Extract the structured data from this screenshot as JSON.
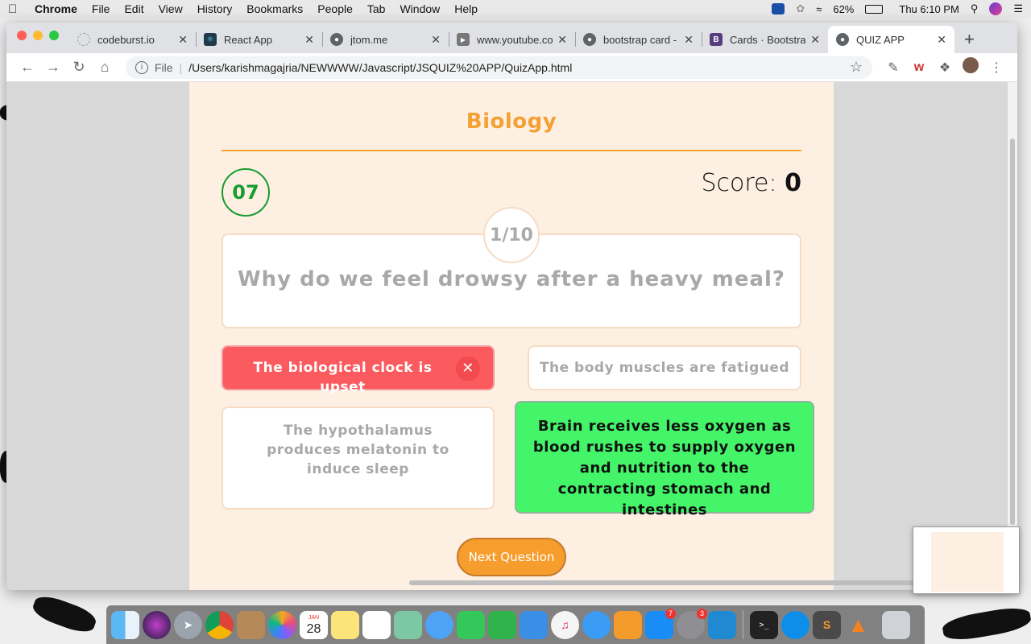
{
  "menubar": {
    "app": "Chrome",
    "items": [
      "File",
      "Edit",
      "View",
      "History",
      "Bookmarks",
      "People",
      "Tab",
      "Window",
      "Help"
    ],
    "battery": "62%",
    "clock": "Thu 6:10 PM"
  },
  "browser": {
    "tabs": [
      {
        "title": "codeburst.io",
        "icon": "codeburst-icon",
        "color": "#888888"
      },
      {
        "title": "React App",
        "icon": "react-icon",
        "color": "#1f3a4a"
      },
      {
        "title": "jtom.me",
        "icon": "globe-icon",
        "color": "#5f6368"
      },
      {
        "title": "www.youtube.com",
        "icon": "youtube-icon",
        "color": "#777777"
      },
      {
        "title": "bootstrap card -",
        "icon": "globe-icon",
        "color": "#5f6368"
      },
      {
        "title": "Cards · Bootstrap",
        "icon": "bootstrap-icon",
        "color": "#563d7c"
      },
      {
        "title": "QUIZ APP",
        "icon": "globe-icon",
        "color": "#5f6368"
      }
    ],
    "address": {
      "scheme": "File",
      "url": "/Users/karishmagajria/NEWWWW/Javascript/JSQUIZ%20APP/QuizApp.html"
    }
  },
  "quiz": {
    "subject": "Biology",
    "timer": "07",
    "score_label": "Score:",
    "score": "0",
    "progress": "1/10",
    "question": "Why do we feel drowsy after a heavy meal?",
    "options": [
      {
        "text": "The biological clock is upset",
        "state": "wrong"
      },
      {
        "text": "The body muscles are fatigued",
        "state": "neutral"
      },
      {
        "text": "The hypothalamus produces melatonin to induce sleep",
        "state": "neutral"
      },
      {
        "text": "Brain receives less oxygen as blood rushes to supply oxygen and nutrition to the contracting stomach and intestines",
        "state": "correct"
      }
    ],
    "next_label": "Next Question",
    "colors": {
      "accent": "#f5a033",
      "wrong": "#fb5a5e",
      "correct": "#44f569",
      "timer": "#179c2f"
    }
  },
  "dock": {
    "calendar_month": "JAN",
    "calendar_day": "28",
    "appstore_badge": "7",
    "prefs_badge": "3"
  }
}
